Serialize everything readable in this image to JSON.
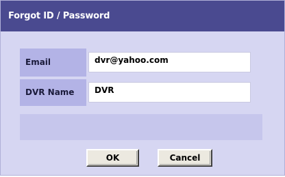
{
  "dialog": {
    "title": "Forgot ID / Password"
  },
  "form": {
    "email": {
      "label": "Email",
      "value": "dvr@yahoo.com"
    },
    "dvr_name": {
      "label": "DVR Name",
      "value": "DVR"
    }
  },
  "buttons": {
    "ok_label": "OK",
    "cancel_label": "Cancel"
  },
  "colors": {
    "title_bar": "#4a4a90",
    "dialog_bg": "#d6d6f2",
    "label_bg": "#b3b3e6"
  }
}
